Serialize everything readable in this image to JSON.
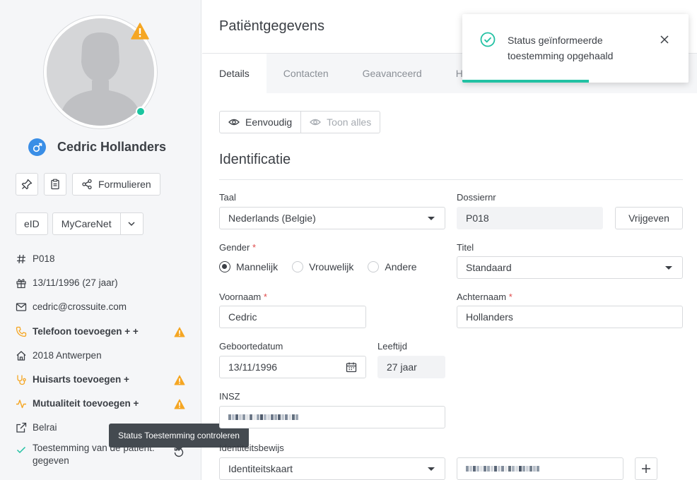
{
  "sidebar": {
    "patient_name": "Cedric Hollanders",
    "buttons": {
      "forms_label": "Formulieren",
      "eid_label": "eID",
      "mycarenet_label": "MyCareNet"
    },
    "info": {
      "dossier_nr": "P018",
      "birthdate": "13/11/1996 (27 jaar)",
      "email": "cedric@crossuite.com",
      "phone": "Telefoon toevoegen + +",
      "address": "2018 Antwerpen",
      "gp": "Huisarts toevoegen +",
      "mutuality": "Mutualiteit toevoegen +",
      "belrai": "Belrai",
      "consent": "Toestemming van de patiënt: gegeven"
    },
    "tooltip": "Status Toestemming controleren",
    "colors": {
      "warning": "#f5a623",
      "online": "#1bc5a0",
      "gender": "#3a8ee6",
      "success": "#22c1a3"
    }
  },
  "main": {
    "title": "Patiëntgegevens",
    "tabs": [
      "Details",
      "Contacten",
      "Geavanceerd",
      "H"
    ],
    "view_toggle": {
      "simple": "Eenvoudig",
      "all": "Toon alles"
    },
    "section_title": "Identificatie",
    "form": {
      "language_label": "Taal",
      "language_value": "Nederlands (Belgie)",
      "dossier_label": "Dossiernr",
      "dossier_value": "P018",
      "release_button": "Vrijgeven",
      "gender_label": "Gender",
      "gender_options": [
        "Mannelijk",
        "Vrouwelijk",
        "Andere"
      ],
      "gender_selected": "Mannelijk",
      "title_label": "Titel",
      "title_value": "Standaard",
      "firstname_label": "Voornaam",
      "firstname_value": "Cedric",
      "lastname_label": "Achternaam",
      "lastname_value": "Hollanders",
      "birthdate_label": "Geboortedatum",
      "birthdate_value": "13/11/1996",
      "age_label": "Leeftijd",
      "age_value": "27 jaar",
      "insz_label": "INSZ",
      "id_doc_label": "Identiteitsbewijs",
      "id_doc_value": "Identiteitskaart",
      "required_mark": "*"
    }
  },
  "toast": {
    "message": "Status geïnformeerde toestemming opgehaald",
    "progress": 0.56
  }
}
